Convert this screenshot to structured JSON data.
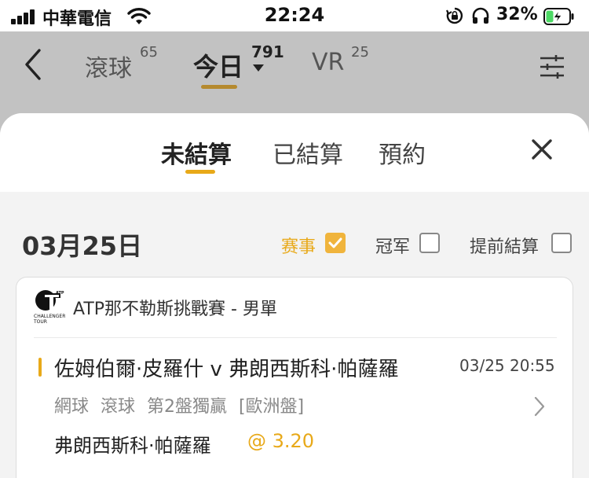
{
  "status_bar": {
    "carrier": "中華電信",
    "time": "22:24",
    "battery": "32%",
    "battery_level": 0.32
  },
  "header": {
    "tabs": [
      {
        "label": "滾球",
        "count": "65"
      },
      {
        "label": "今日",
        "count": "791"
      },
      {
        "label": "VR",
        "count": "25"
      }
    ],
    "active_tab": "今日"
  },
  "sheet": {
    "tabs": [
      "未結算",
      "已結算",
      "預約"
    ],
    "active_tab": "未結算"
  },
  "filters": {
    "date": "03月25日",
    "options": [
      {
        "label": "赛事",
        "checked": true,
        "color": "#e8a919"
      },
      {
        "label": "冠军",
        "checked": false
      },
      {
        "label": "提前結算",
        "checked": false
      }
    ]
  },
  "bet_card": {
    "league": "ATP那不勒斯挑戰賽 - 男單",
    "logo_text": "CHALLENGER TOUR",
    "match": "佐姆伯爾·皮羅什 v 弗朗西斯科·帕薩羅",
    "datetime": "03/25 20:55",
    "bet_info": "網球 滾球 第2盤獨贏 [歐洲盤]",
    "selection": "弗朗西斯科·帕薩羅",
    "odds": "@ 3.20"
  },
  "colors": {
    "accent": "#e8a919",
    "underline_header": "#b58a2e",
    "battery_fill": "#4cd964"
  }
}
